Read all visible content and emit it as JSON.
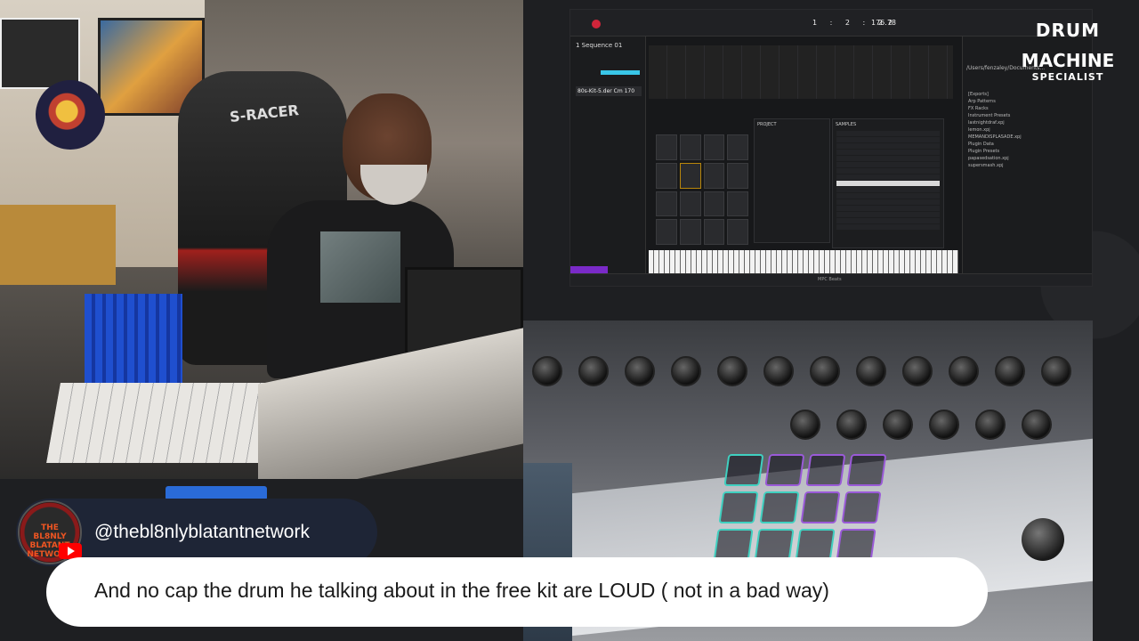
{
  "daw": {
    "sequence_name": "1 Sequence 01",
    "kit_name": "80s-Kit-5.der Cm 170",
    "bpm": "176.78",
    "position": "1 : 2 : 22",
    "browser_path": "/Users/fenzaley/Documents...",
    "browser_items": [
      "[Exports]",
      "Arp Patterns",
      "FX Racks",
      "Instrument Presets",
      "lastnightdraf.xpj",
      "lemon.xpj",
      "MEMANDISPLASADE.xpj",
      "Plugin Data",
      "Plugin Presets",
      "papasedsation.xpj",
      "supersmash.xpj"
    ],
    "project_label": "PROJECT",
    "samples_label": "SAMPLES",
    "app_title": "MPC Beats"
  },
  "brand": {
    "line1": "DRUM",
    "line2": "MACHINE",
    "line3": "SPECIALIST"
  },
  "chat": {
    "username": "@thebl8nlyblatantnetwork",
    "avatar_text": "THE BL8NLY BLATANT NETWORK",
    "message": "And no cap the drum he talking about in the free kit are LOUD ( not in a bad way)"
  },
  "colors": {
    "chat_pill": "#1e2536",
    "message_bg": "#ffffff",
    "youtube_red": "#ff0000",
    "pad_colors": [
      "#3fd0c0",
      "#9a5ad8",
      "#3fd0c0",
      "#9a5ad8"
    ]
  },
  "icons": {
    "youtube": "youtube-icon",
    "record": "record-icon"
  }
}
